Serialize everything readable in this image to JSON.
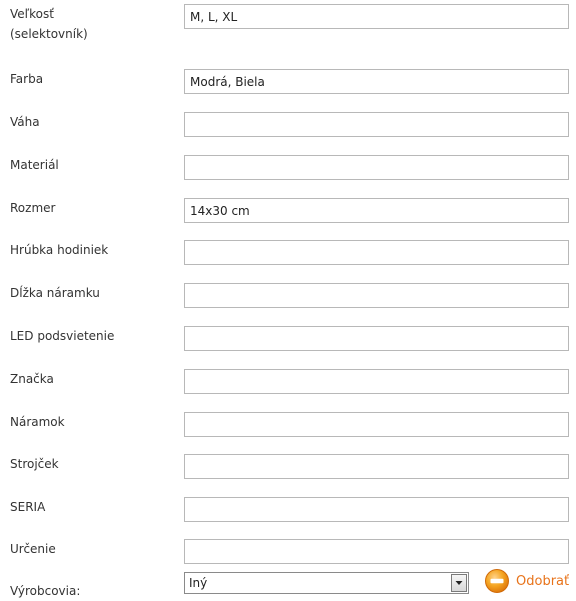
{
  "form": {
    "fields": [
      {
        "label": "Veľkosť\n(selektovník)",
        "value": "M, L, XL"
      },
      {
        "label": "Farba",
        "value": "Modrá, Biela"
      },
      {
        "label": "Váha",
        "value": ""
      },
      {
        "label": "Materiál",
        "value": ""
      },
      {
        "label": "Rozmer",
        "value": "14x30 cm"
      },
      {
        "label": "Hrúbka hodiniek",
        "value": ""
      },
      {
        "label": "Dĺžka náramku",
        "value": ""
      },
      {
        "label": "LED podsvietenie",
        "value": ""
      },
      {
        "label": "Značka",
        "value": ""
      },
      {
        "label": "Náramok",
        "value": ""
      },
      {
        "label": "Strojček",
        "value": ""
      },
      {
        "label": "SERIA",
        "value": ""
      },
      {
        "label": "Určenie",
        "value": ""
      }
    ],
    "manufacturers": {
      "label": "Výrobcovia:",
      "selected": "Iný",
      "remove_label": "Odobrať"
    }
  },
  "colors": {
    "accent": "#e8731a",
    "field_border": "#b8b8b8"
  },
  "icons": {
    "dropdown": "chevron-down-icon",
    "remove": "minus-circle-icon"
  }
}
